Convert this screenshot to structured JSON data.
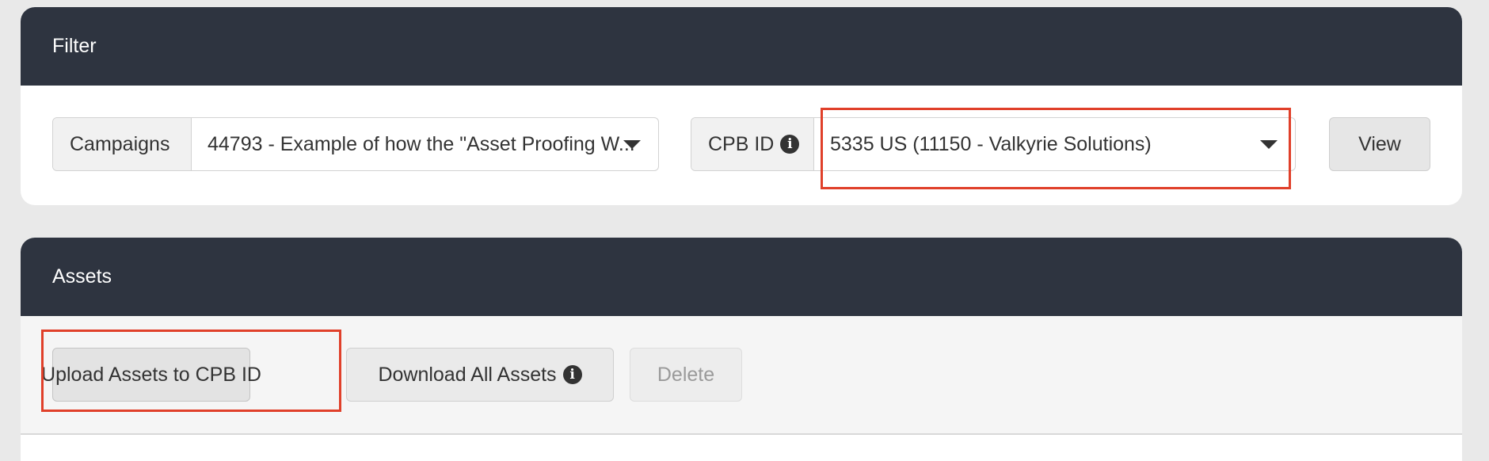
{
  "filter": {
    "title": "Filter",
    "campaigns": {
      "label": "Campaigns",
      "value": "44793 - Example of how the \"Asset Proofing W..."
    },
    "cpb": {
      "label": "CPB ID",
      "info_icon": "info-icon",
      "value": "5335 US (11150 - Valkyrie Solutions)"
    },
    "view_label": "View"
  },
  "assets": {
    "title": "Assets",
    "upload_label": "Upload Assets to CPB ID",
    "download_label": "Download All Assets",
    "download_info_icon": "info-icon",
    "delete_label": "Delete"
  },
  "annotations": {
    "highlight_color": "#e0402a"
  },
  "colors": {
    "header_bg": "#2e3440",
    "page_bg": "#e9e9e9"
  }
}
